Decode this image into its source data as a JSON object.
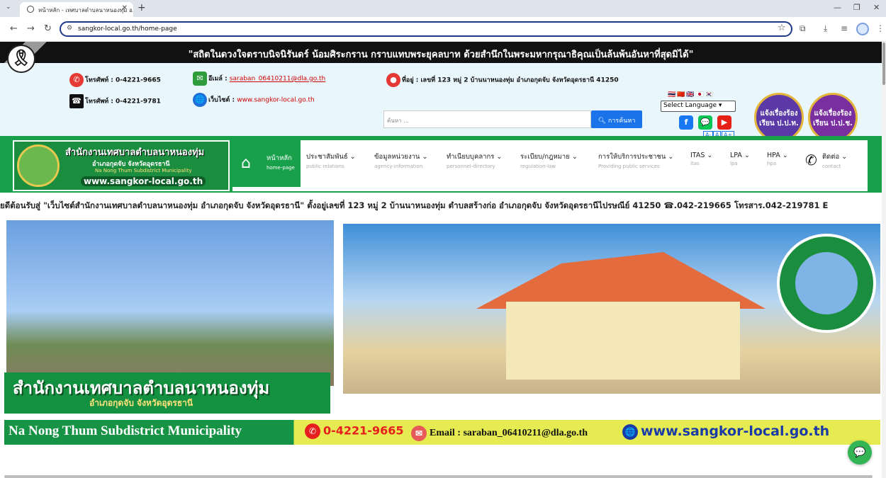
{
  "browser": {
    "tab_title": "หน้าหลัก - เทศบาลตำบลนาหนองทุ่ม อ.กุดจับ",
    "url": "sangkor-local.go.th/home-page"
  },
  "mourning": {
    "text": "\"สถิตในดวงใจตราบนิจนิรันดร์ น้อมศิระกราน กราบแทบพระยุคลบาท ด้วยสำนึกในพระมหากรุณาธิคุณเป็นล้นพ้นอันหาที่สุดมิได้\""
  },
  "contact": {
    "phone1": "โทรศัพท์ : 0-4221-9665",
    "phone2": "โทรศัพท์ : 0-4221-9781",
    "email_label": "อีเมล์ : ",
    "email": "saraban_06410211@dla.go.th",
    "web_label": "เว็บไซต์ : ",
    "web": "www.sangkor-local.go.th",
    "address": "ที่อยู่ : เลขที่ 123 หมู่ 2 บ้านนาหนองทุ่ม อำเภอกุดจับ จังหวัดอุดรธานี 41250",
    "search_placeholder": "ค้นหา ...",
    "search_button": "การค้นหา",
    "language_select": "Select Language",
    "font_small": "A-",
    "font_normal": "A",
    "font_large": "A+",
    "emblem1": "แจ้งเรื่องร้องเรียน ป.ป.ท.",
    "emblem2": "แจ้งเรื่องร้องเรียน ป.ป.ช."
  },
  "logo": {
    "title": "สำนักงานเทศบาลตำบลนาหนองทุ่ม",
    "subtitle": "อำเภอกุดจับ จังหวัดอุดรธานี",
    "english": "Na Nong Thum Subdistrict Municipality",
    "web": "www.sangkor-local.go.th"
  },
  "menu": [
    {
      "label": "หน้าหลัก",
      "sub": "home-page"
    },
    {
      "label": "ประชาสัมพันธ์",
      "sub": "public relations"
    },
    {
      "label": "ข้อมูลหน่วยงาน",
      "sub": "agency-information"
    },
    {
      "label": "ทำเนียบบุคลากร",
      "sub": "personnel-directory"
    },
    {
      "label": "ระเบียบ/กฎหมาย",
      "sub": "regulation-law"
    },
    {
      "label": "การให้บริการประชาชน",
      "sub": "Providing public services"
    },
    {
      "label": "ITAS",
      "sub": "itas"
    },
    {
      "label": "LPA",
      "sub": "lpa"
    },
    {
      "label": "HPA",
      "sub": "hpa"
    },
    {
      "label": "ติดต่อ",
      "sub": "contact"
    }
  ],
  "marquee": "ยดีต้อนรับสู่ \"เว็บไซต์สำนักงานเทศบาลตำบลนาหนองทุ่ม อำเภอกุดจับ จังหวัดอุดรธานี\" ตั้งอยู่เลขที่ 123 หมู่ 2 บ้านนาหนองทุ่ม ตำบลสร้างก่อ อำเภอกุดจับ จังหวัดอุดรธานีไปรษณีย์ 41250 ☎.042-219665 โทรสาร.042-219781 E",
  "banner": {
    "title": "สำนักงานเทศบาลตำบลนาหนองทุ่ม",
    "subtitle": "อำเภอกุดจับ จังหวัดอุดรธานี",
    "name_en": "Na Nong Thum Subdistrict Municipality",
    "phone": "0-4221-9665",
    "email": "Email : saraban_06410211@dla.go.th",
    "web": "www.sangkor-local.go.th"
  },
  "colors": {
    "brand_green": "#19a04b",
    "link_red": "#cc0000",
    "search_blue": "#1a73e8",
    "banner_yellow": "#e5eb50"
  }
}
